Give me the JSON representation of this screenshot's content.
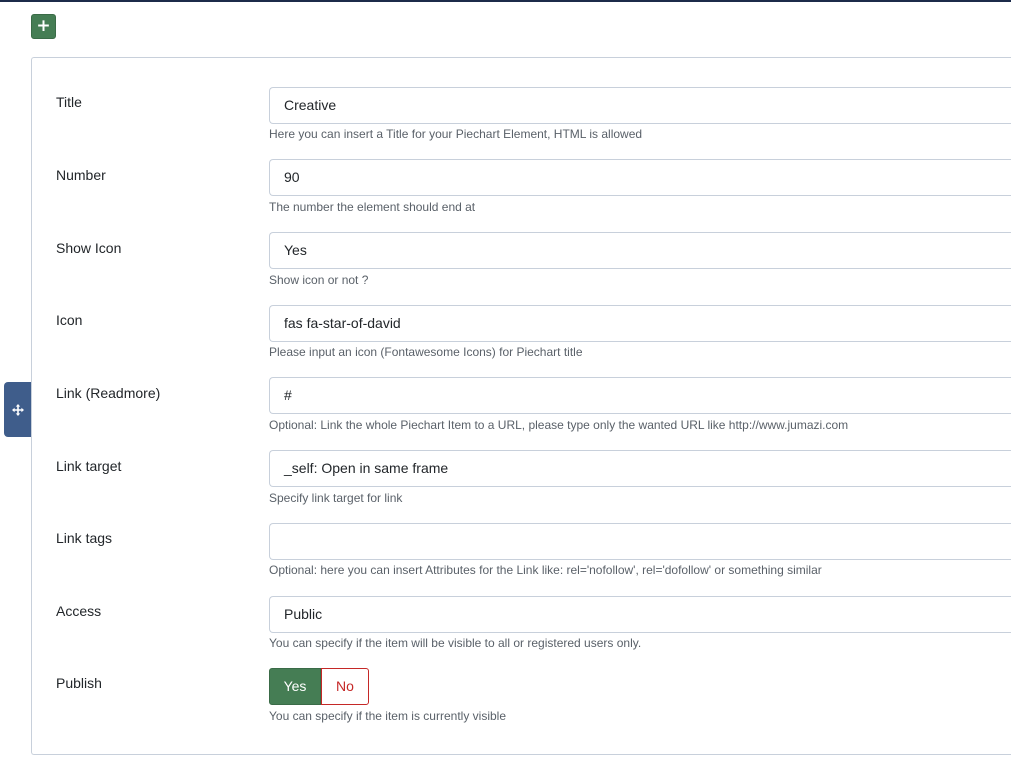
{
  "toolbar": {
    "add_glyph": "+",
    "add_icon": "plus-icon"
  },
  "handle": {
    "icon": "move-arrows-icon"
  },
  "colors": {
    "success": "#457d54",
    "danger": "#c52827",
    "handle": "#3f5d8b",
    "border": "#c8d0db"
  },
  "fields": {
    "title": {
      "label": "Title",
      "value": "Creative",
      "help": "Here you can insert a Title for your Piechart Element, HTML is allowed"
    },
    "number": {
      "label": "Number",
      "value": "90",
      "help": "The number the element should end at"
    },
    "show_icon": {
      "label": "Show Icon",
      "value": "Yes",
      "help": "Show icon or not ?"
    },
    "icon": {
      "label": "Icon",
      "value": "fas fa-star-of-david",
      "help": "Please input an icon (Fontawesome Icons) for Piechart title"
    },
    "link": {
      "label": "Link (Readmore)",
      "value": "#",
      "help": "Optional: Link the whole Piechart Item to a URL, please type only the wanted URL like http://www.jumazi.com"
    },
    "link_target": {
      "label": "Link target",
      "value": "_self: Open in same frame",
      "help": "Specify link target for link"
    },
    "link_tags": {
      "label": "Link tags",
      "value": "",
      "help": "Optional: here you can insert Attributes for the Link like: rel='nofollow', rel='dofollow' or something similar"
    },
    "access": {
      "label": "Access",
      "value": "Public",
      "help": "You can specify if the item will be visible to all or registered users only."
    },
    "publish": {
      "label": "Publish",
      "yes_label": "Yes",
      "no_label": "No",
      "selected": "Yes",
      "help": "You can specify if the item is currently visible"
    }
  }
}
